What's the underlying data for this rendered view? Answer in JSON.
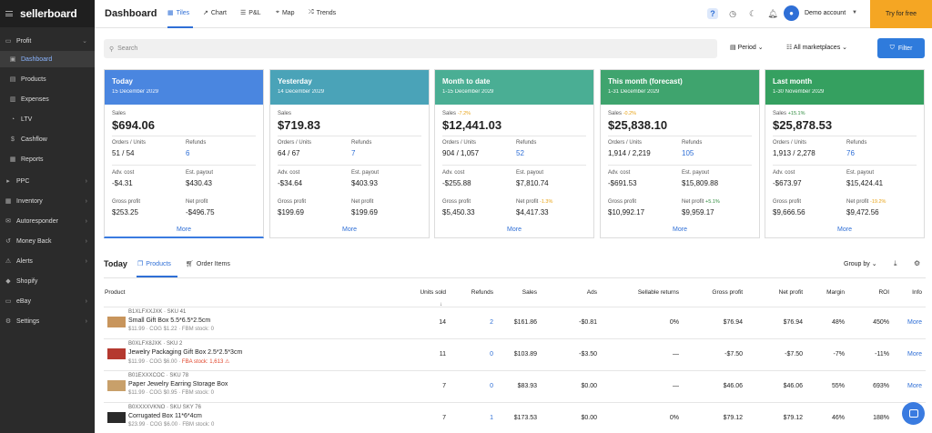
{
  "app": {
    "logo": "sellerboard",
    "page_title": "Dashboard"
  },
  "view_tabs": [
    {
      "label": "Tiles",
      "icon": "grid-icon"
    },
    {
      "label": "Chart",
      "icon": "chart-line-icon"
    },
    {
      "label": "P&L",
      "icon": "list-icon"
    },
    {
      "label": "Map",
      "icon": "map-pin-icon"
    },
    {
      "label": "Trends",
      "icon": "trends-icon"
    }
  ],
  "header": {
    "help_label": "?",
    "account_label": "Demo account",
    "try_label": "Try for free"
  },
  "sidebar": {
    "items": [
      {
        "label": "Profit",
        "icon": "profit-icon",
        "chevron": "⌄"
      },
      {
        "label": "Dashboard",
        "icon": "dashboard-icon",
        "chevron": ""
      },
      {
        "label": "Products",
        "icon": "products-icon",
        "chevron": ""
      },
      {
        "label": "Expenses",
        "icon": "expenses-icon",
        "chevron": ""
      },
      {
        "label": "LTV",
        "icon": "ltv-icon",
        "chevron": ""
      },
      {
        "label": "Cashflow",
        "icon": "cashflow-icon",
        "chevron": ""
      },
      {
        "label": "Reports",
        "icon": "reports-icon",
        "chevron": ""
      },
      {
        "label": "PPC",
        "icon": "ppc-icon",
        "chevron": "›"
      },
      {
        "label": "Inventory",
        "icon": "inventory-icon",
        "chevron": "›"
      },
      {
        "label": "Autoresponder",
        "icon": "autoresponder-icon",
        "chevron": "›"
      },
      {
        "label": "Money Back",
        "icon": "money-back-icon",
        "chevron": "›"
      },
      {
        "label": "Alerts",
        "icon": "alerts-icon",
        "chevron": "›"
      },
      {
        "label": "Shopify",
        "icon": "shopify-icon",
        "chevron": ""
      },
      {
        "label": "eBay",
        "icon": "ebay-icon",
        "chevron": "›"
      },
      {
        "label": "Settings",
        "icon": "settings-icon",
        "chevron": "›"
      }
    ]
  },
  "toolbar": {
    "search_placeholder": "Search",
    "period_label": "Period",
    "marketplaces_label": "All marketplaces",
    "filter_label": "Filter"
  },
  "labels": {
    "sales": "Sales",
    "orders_units": "Orders / Units",
    "refunds": "Refunds",
    "adv_cost": "Adv. cost",
    "est_payout": "Est. payout",
    "gross_profit": "Gross profit",
    "net_profit": "Net profit",
    "more": "More"
  },
  "cards": [
    {
      "title": "Today",
      "date": "15 December 2029",
      "color": "#4a86e0",
      "sales_change": "",
      "sales": "$694.06",
      "orders_units": "51 / 54",
      "refunds": "6",
      "adv_cost": "-$4.31",
      "est_payout": "$430.43",
      "gross_profit": "$253.25",
      "net_profit": "-$496.75",
      "net_change": ""
    },
    {
      "title": "Yesterday",
      "date": "14 December 2029",
      "color": "#4aa3b8",
      "sales_change": "",
      "sales": "$719.83",
      "orders_units": "64 / 67",
      "refunds": "7",
      "adv_cost": "-$34.64",
      "est_payout": "$403.93",
      "gross_profit": "$199.69",
      "net_profit": "$199.69",
      "net_change": ""
    },
    {
      "title": "Month to date",
      "date": "1-15 December 2029",
      "color": "#4aae94",
      "sales_change": "-7.2%",
      "sales": "$12,441.03",
      "orders_units": "904 / 1,057",
      "refunds": "52",
      "adv_cost": "-$255.88",
      "est_payout": "$7,810.74",
      "gross_profit": "$5,450.33",
      "net_profit": "$4,417.33",
      "net_change": "-1.3%"
    },
    {
      "title": "This month (forecast)",
      "date": "1-31 December 2029",
      "color": "#3fa46e",
      "sales_change": "-0.2%",
      "sales": "$25,838.10",
      "orders_units": "1,914 / 2,219",
      "refunds": "105",
      "adv_cost": "-$691.53",
      "est_payout": "$15,809.88",
      "gross_profit": "$10,992.17",
      "net_profit": "$9,959.17",
      "net_change": "+5.1%"
    },
    {
      "title": "Last month",
      "date": "1-30 November 2029",
      "color": "#35a060",
      "sales_change": "+15.1%",
      "sales": "$25,878.53",
      "orders_units": "1,913 / 2,278",
      "refunds": "76",
      "adv_cost": "-$673.97",
      "est_payout": "$15,424.41",
      "gross_profit": "$9,666.56",
      "net_profit": "$9,472.56",
      "net_change": "-19.2%"
    }
  ],
  "lower": {
    "today_label": "Today",
    "tab_products": "Products",
    "tab_order_items": "Order Items",
    "group_by": "Group by"
  },
  "table": {
    "headers": {
      "product": "Product",
      "units_sold": "Units sold",
      "refunds": "Refunds",
      "sales": "Sales",
      "ads": "Ads",
      "sellable_returns": "Sellable returns",
      "gross_profit": "Gross profit",
      "net_profit": "Net profit",
      "margin": "Margin",
      "roi": "ROI",
      "info": "Info"
    },
    "rows": [
      {
        "sku_line": "B1XLFXXJXK · SKU 41",
        "name": "Small Gift Box 5.5*6.5*2.5cm",
        "cog": "$11.99 · COG $1.22 · ",
        "stock": "FBM stock: 0",
        "stock_warn": false,
        "units": "14",
        "refunds": "2",
        "sales": "$161.86",
        "ads": "-$0.81",
        "returns": "0%",
        "gross": "$76.94",
        "net": "$76.94",
        "margin": "48%",
        "roi": "450%",
        "info": "More"
      },
      {
        "sku_line": "B0XLFX8JXK · SKU 2",
        "name": "Jewelry Packaging Gift Box 2.5*2.5*3cm",
        "cog": "$11.99 · COG $6.00 · ",
        "stock": "FBA stock: 1,613 ⚠",
        "stock_warn": true,
        "units": "11",
        "refunds": "0",
        "sales": "$103.89",
        "ads": "-$3.50",
        "returns": "—",
        "gross": "-$7.50",
        "net": "-$7.50",
        "margin": "-7%",
        "roi": "-11%",
        "info": "More"
      },
      {
        "sku_line": "B01EXXXCOC · SKU 78",
        "name": "Paper Jewelry Earring Storage Box",
        "cog": "$11.99 · COG $0.95 · ",
        "stock": "FBM stock: 0",
        "stock_warn": false,
        "units": "7",
        "refunds": "0",
        "sales": "$83.93",
        "ads": "$0.00",
        "returns": "—",
        "gross": "$46.06",
        "net": "$46.06",
        "margin": "55%",
        "roi": "693%",
        "info": "More"
      },
      {
        "sku_line": "B0XXXXVKNO · SKU SKY 76",
        "name": "Corrugated Box 11*6*4cm",
        "cog": "$23.99 · COG $6.00 · ",
        "stock": "FBM stock: 0",
        "stock_warn": false,
        "units": "7",
        "refunds": "1",
        "sales": "$173.53",
        "ads": "$0.00",
        "returns": "0%",
        "gross": "$79.12",
        "net": "$79.12",
        "margin": "46%",
        "roi": "188%",
        "info": "More"
      }
    ]
  }
}
